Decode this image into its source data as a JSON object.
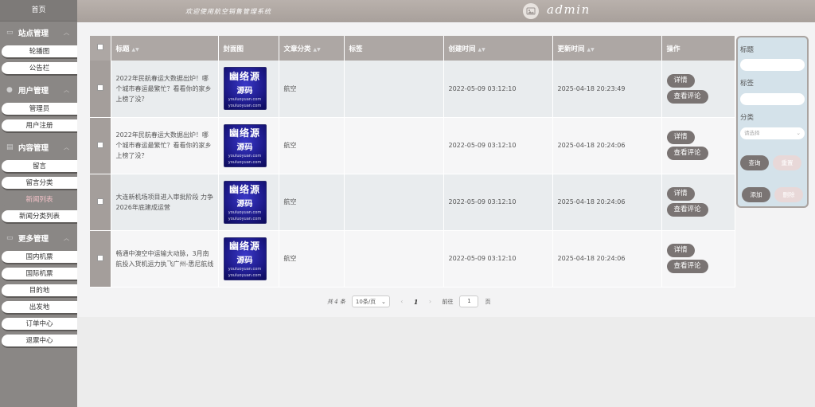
{
  "sidebar": {
    "home": "首页",
    "groups": [
      {
        "label": "站点管理",
        "items": [
          "轮播图",
          "公告栏"
        ]
      },
      {
        "label": "用户管理",
        "items": [
          "管理员",
          "用户注册"
        ]
      },
      {
        "label": "内容管理",
        "items": [
          "留言",
          "留言分类",
          "新闻列表",
          "新闻分类列表"
        ],
        "active": "新闻列表"
      },
      {
        "label": "更多管理",
        "items": [
          "国内机票",
          "国际机票",
          "目的地",
          "出发地",
          "订单中心",
          "退票中心"
        ]
      }
    ]
  },
  "header": {
    "welcome": "欢迎使用航空销售管理系统",
    "username": "admin"
  },
  "table": {
    "headers": [
      "标题",
      "封面图",
      "文章分类",
      "标签",
      "创建时间",
      "更新时间",
      "操作"
    ],
    "cover": {
      "line1": "幽络源",
      "line2": "源码",
      "line3a": "youluoyuan.com",
      "line3b": "youluoyuan.com"
    },
    "rows": [
      {
        "title": "2022年民航春运大数据出炉！哪个城市春运最繁忙？看看你的家乡上榜了没？",
        "category": "航空",
        "tag": "",
        "created": "2022-05-09 03:12:10",
        "updated": "2025-04-18 20:23:49"
      },
      {
        "title": "2022年民航春运大数据出炉！哪个城市春运最繁忙？看看你的家乡上榜了没？",
        "category": "航空",
        "tag": "",
        "created": "2022-05-09 03:12:10",
        "updated": "2025-04-18 20:24:06"
      },
      {
        "title": "大连新机场项目进入审批阶段 力争2026年底建成运营",
        "category": "航空",
        "tag": "",
        "created": "2022-05-09 03:12:10",
        "updated": "2025-04-18 20:24:06"
      },
      {
        "title": "畅通中澳空中运输大动脉，3月南航投入货机运力执飞广州-悉尼航线",
        "category": "航空",
        "tag": "",
        "created": "2022-05-09 03:12:10",
        "updated": "2025-04-18 20:24:06"
      }
    ],
    "detail_label": "详情",
    "comment_label": "查看评论"
  },
  "pager": {
    "total": "共 4 条",
    "page_size": "10条/页",
    "page": "1",
    "goto_label": "前往",
    "goto_value": "1",
    "page_unit": "页"
  },
  "search": {
    "title_label": "标题",
    "tag_label": "标签",
    "category_label": "分类",
    "category_placeholder": "请选择",
    "query_label": "查询",
    "reset_label": "重置",
    "add_label": "添加",
    "delete_label": "删除"
  }
}
